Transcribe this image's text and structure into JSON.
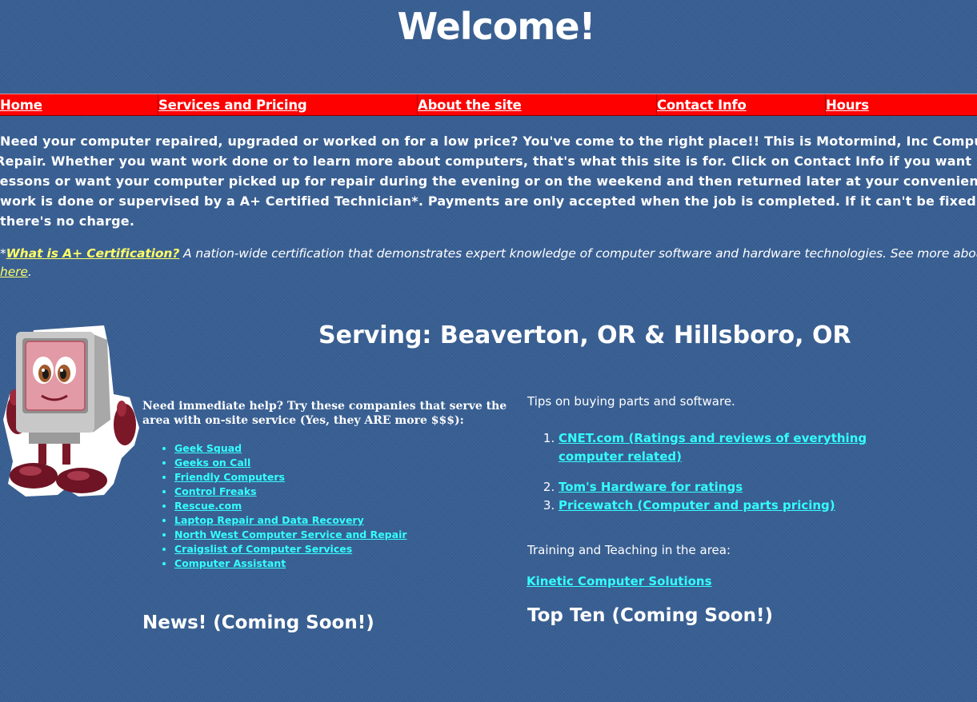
{
  "page": {
    "title": "Welcome!"
  },
  "nav": {
    "items": [
      {
        "label": "Home"
      },
      {
        "label": "Services and Pricing"
      },
      {
        "label": "About the site"
      },
      {
        "label": "Contact Info"
      },
      {
        "label": "Hours"
      }
    ]
  },
  "intro": {
    "lines": [
      "Need your computer repaired, upgraded or worked on for a low price? You've come to the right place!! This is Motormind, Inc Computer",
      "Repair. Whether you want work done or to learn more about computers, that's what this site is for. Click on Contact Info if you want",
      "lessons or want your computer picked up for repair during the evening or on the weekend and then returned later at your convenience. All",
      "work is done or supervised by a A+ Certified Technician*. Payments are only accepted when the job is completed. If it can't be fixed here",
      "there's no charge."
    ]
  },
  "certification": {
    "asterisk": "*",
    "link": "What is A+ Certification?",
    "description": " A nation-wide certification that demonstrates expert knowledge of computer software and hardware technologies. See more about it",
    "here_link": "here",
    "period": "."
  },
  "serving": {
    "heading": "Serving: Beaverton, OR & Hillsboro, OR"
  },
  "help": {
    "intro": "Need immediate help? Try these companies that serve the area with on-site service (Yes, they ARE more $$$):",
    "companies": [
      {
        "label": "Geek Squad"
      },
      {
        "label": "Geeks on Call"
      },
      {
        "label": "Friendly Computers"
      },
      {
        "label": "Control Freaks"
      },
      {
        "label": "Rescue.com"
      },
      {
        "label": "Laptop Repair and Data Recovery"
      },
      {
        "label": "North West Computer Service and Repair"
      },
      {
        "label": "Craigslist of Computer Services"
      },
      {
        "label": "Computer Assistant"
      }
    ]
  },
  "news": {
    "heading": "News! (Coming Soon!)"
  },
  "tips": {
    "heading": "Tips on buying parts and software.",
    "items": [
      {
        "label": "CNET.com (Ratings and reviews of everything computer related)"
      },
      {
        "label": "Tom's Hardware for ratings"
      },
      {
        "label": "Pricewatch (Computer and parts pricing)"
      }
    ]
  },
  "training": {
    "heading": "Training and Teaching in the area:",
    "link": "Kinetic Computer Solutions"
  },
  "topten": {
    "heading": "Top Ten (Coming Soon!)"
  },
  "colors": {
    "background": "#385f93",
    "nav_bar": "#ff0000",
    "link": "#33ffff",
    "cert_link": "#ffff66"
  },
  "mascot": {
    "icon": "computer-mascot-icon"
  }
}
